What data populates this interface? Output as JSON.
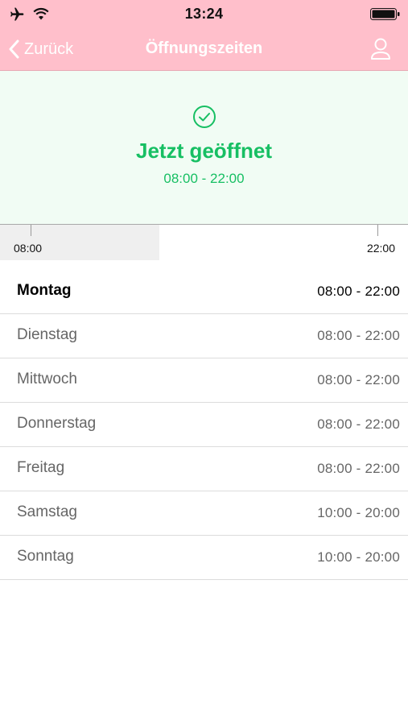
{
  "status_bar": {
    "time": "13:24",
    "icons": [
      "airplane-icon",
      "wifi-icon",
      "battery-icon"
    ]
  },
  "nav": {
    "back_label": "Zurück",
    "title": "Öffnungszeiten",
    "right_icon": "user-icon"
  },
  "banner": {
    "icon": "check-circle-icon",
    "title": "Jetzt geöffnet",
    "hours": "08:00 - 22:00"
  },
  "timeline": {
    "start_label": "08:00",
    "end_label": "22:00",
    "elapsed_fraction": 0.39
  },
  "days": [
    {
      "name": "Montag",
      "hours": "08:00 - 22:00",
      "current": true
    },
    {
      "name": "Dienstag",
      "hours": "08:00 - 22:00",
      "current": false
    },
    {
      "name": "Mittwoch",
      "hours": "08:00 - 22:00",
      "current": false
    },
    {
      "name": "Donnerstag",
      "hours": "08:00 - 22:00",
      "current": false
    },
    {
      "name": "Freitag",
      "hours": "08:00 - 22:00",
      "current": false
    },
    {
      "name": "Samstag",
      "hours": "10:00 - 20:00",
      "current": false
    },
    {
      "name": "Sonntag",
      "hours": "10:00 - 20:00",
      "current": false
    }
  ],
  "colors": {
    "header_bg": "#ffbfcb",
    "banner_bg": "#f1fcf4",
    "accent_green": "#17bf63",
    "text_secondary": "#666666"
  }
}
